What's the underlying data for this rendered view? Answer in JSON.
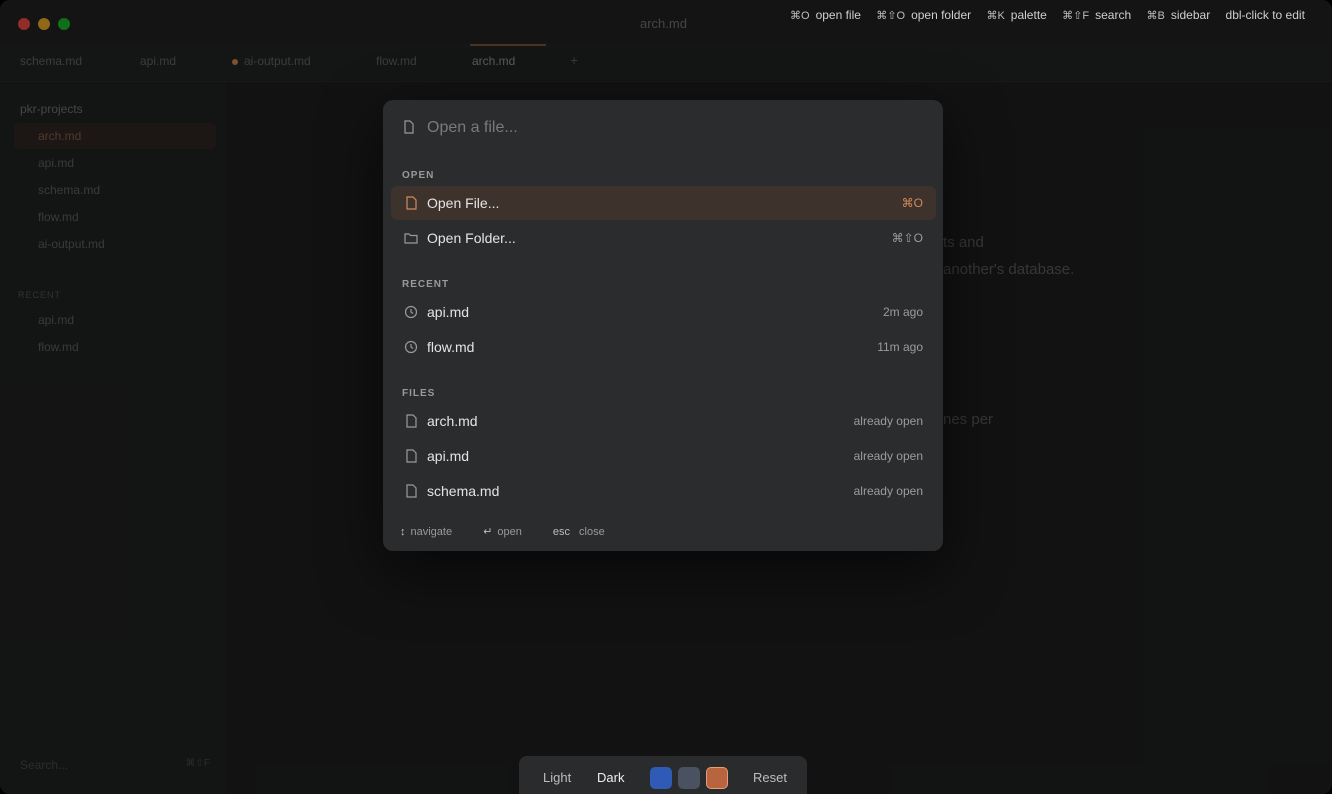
{
  "window": {
    "title": "arch.md"
  },
  "tabs": [
    {
      "label": "schema.md"
    },
    {
      "label": "api.md"
    },
    {
      "label": "ai-output.md"
    },
    {
      "label": "flow.md"
    },
    {
      "label": "arch.md"
    }
  ],
  "sidebar": {
    "folder": "pkr-projects",
    "files": [
      {
        "label": "arch.md"
      },
      {
        "label": "api.md"
      },
      {
        "label": "schema.md"
      },
      {
        "label": "flow.md"
      },
      {
        "label": "ai-output.md"
      }
    ],
    "recent_label": "RECENT",
    "recent": [
      {
        "label": "api.md"
      },
      {
        "label": "flow.md"
      }
    ],
    "search_placeholder": "Search...",
    "search_kbd": "⌘⇧F"
  },
  "doc": {
    "line1": "ts and",
    "line2": "another's database.",
    "line3": "nes per"
  },
  "hints": [
    {
      "key": "⌘O",
      "label": "open file"
    },
    {
      "key": "⌘⇧O",
      "label": "open folder"
    },
    {
      "key": "⌘K",
      "label": "palette"
    },
    {
      "key": "⌘⇧F",
      "label": "search"
    },
    {
      "key": "⌘B",
      "label": "sidebar"
    },
    {
      "key": "",
      "label": "dbl-click to edit"
    }
  ],
  "palette": {
    "placeholder": "Open a file...",
    "sections": {
      "open": "OPEN",
      "recent": "RECENT",
      "files": "FILES"
    },
    "open_items": [
      {
        "label": "Open File...",
        "meta": "⌘O",
        "icon": "file-icon"
      },
      {
        "label": "Open Folder...",
        "meta": "⌘⇧O",
        "icon": "folder-icon"
      }
    ],
    "recent_items": [
      {
        "label": "api.md",
        "meta": "2m ago",
        "icon": "clock-icon"
      },
      {
        "label": "flow.md",
        "meta": "11m ago",
        "icon": "clock-icon"
      }
    ],
    "file_items": [
      {
        "label": "arch.md",
        "meta": "already open",
        "icon": "file-icon"
      },
      {
        "label": "api.md",
        "meta": "already open",
        "icon": "file-icon"
      },
      {
        "label": "schema.md",
        "meta": "already open",
        "icon": "file-icon"
      }
    ],
    "footer": {
      "navigate_key": "↕",
      "navigate": "navigate",
      "open_key": "↵",
      "open": "open",
      "close_key": "esc",
      "close": "close"
    }
  },
  "theme": {
    "light": "Light",
    "dark": "Dark",
    "reset": "Reset",
    "swatches": [
      "#2f5bb7",
      "#4a5160",
      "#b8643e"
    ]
  },
  "colors": {
    "accent": "#d18a5b"
  }
}
